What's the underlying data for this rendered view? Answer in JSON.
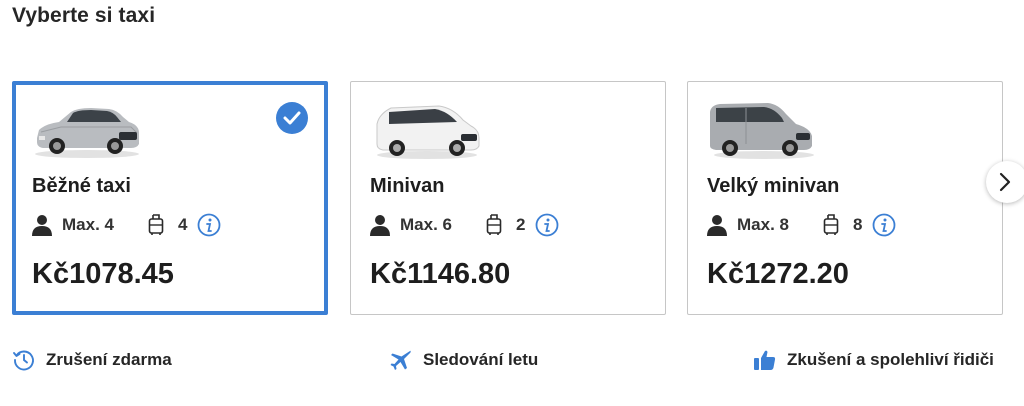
{
  "title": "Vyberte si taxi",
  "accent_color": "#3b7fd4",
  "cards": [
    {
      "name": "Běžné taxi",
      "passengers": "Max. 4",
      "luggage": "4",
      "price": "Kč1078.45",
      "selected": true,
      "image_icon": "sedan-car-icon"
    },
    {
      "name": "Minivan",
      "passengers": "Max. 6",
      "luggage": "2",
      "price": "Kč1146.80",
      "selected": false,
      "image_icon": "minivan-car-icon"
    },
    {
      "name": "Velký minivan",
      "passengers": "Max. 8",
      "luggage": "8",
      "price": "Kč1272.20",
      "selected": false,
      "image_icon": "large-van-icon"
    }
  ],
  "features": [
    {
      "label": "Zrušení zdarma",
      "icon": "clock-history-icon"
    },
    {
      "label": "Sledování letu",
      "icon": "airplane-icon"
    },
    {
      "label": "Zkušení a spolehliví řidiči",
      "icon": "thumbs-up-icon"
    }
  ],
  "next_icon": "chevron-right-icon"
}
